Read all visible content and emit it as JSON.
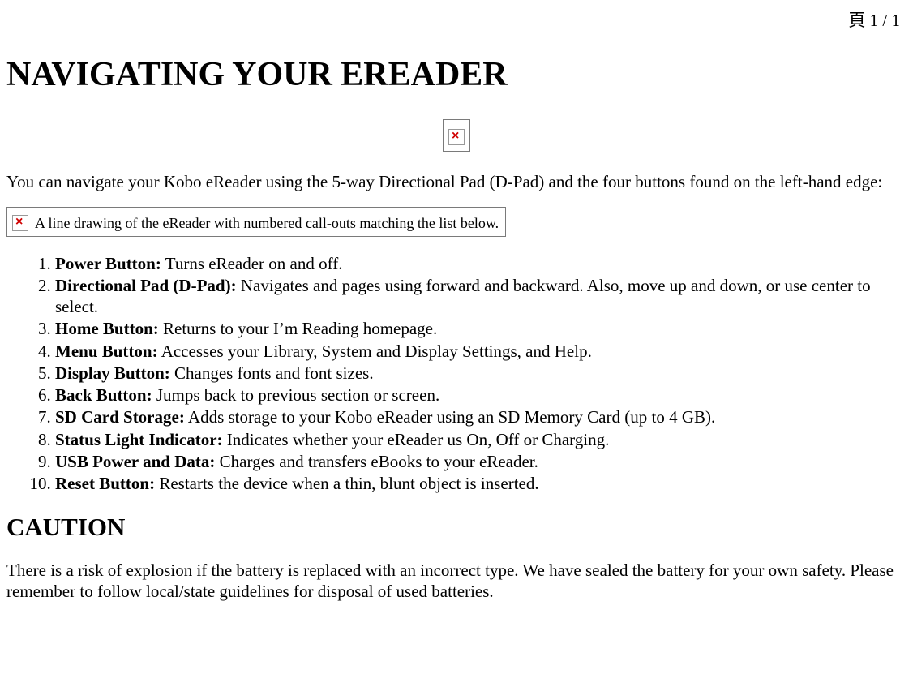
{
  "pageIndicator": "頁 1 / 1",
  "title": "NAVIGATING YOUR EREADER",
  "intro": "You can navigate your Kobo eReader using the 5-way Directional Pad (D-Pad) and the four buttons found on the left-hand edge:",
  "brokenImageAlt": "A line drawing of the eReader with numbered call-outs matching the list below.",
  "items": [
    {
      "title": "Power Button:",
      "desc": " Turns eReader on and off."
    },
    {
      "title": "Directional Pad (D-Pad):",
      "desc": " Navigates and pages using forward and backward. Also, move up and down, or use center to select."
    },
    {
      "title": "Home Button:",
      "desc": " Returns to your I’m Reading homepage."
    },
    {
      "title": "Menu Button:",
      "desc": " Accesses your Library, System and Display Settings, and Help."
    },
    {
      "title": "Display Button:",
      "desc": " Changes fonts and font sizes."
    },
    {
      "title": "Back Button:",
      "desc": " Jumps back to previous section or screen."
    },
    {
      "title": "SD Card Storage:",
      "desc": " Adds storage to your Kobo eReader using an SD Memory Card (up to 4 GB)."
    },
    {
      "title": "Status Light Indicator:",
      "desc": " Indicates whether your eReader us On, Off or Charging."
    },
    {
      "title": "USB Power and Data:",
      "desc": " Charges and transfers eBooks to your eReader."
    },
    {
      "title": "Reset Button:",
      "desc": " Restarts the device when a thin, blunt object is inserted."
    }
  ],
  "cautionHeading": "CAUTION",
  "cautionText": "There is a risk of explosion if the battery is replaced with an incorrect type. We have sealed the battery for your own safety. Please remember to follow local/state guidelines for disposal of used batteries."
}
